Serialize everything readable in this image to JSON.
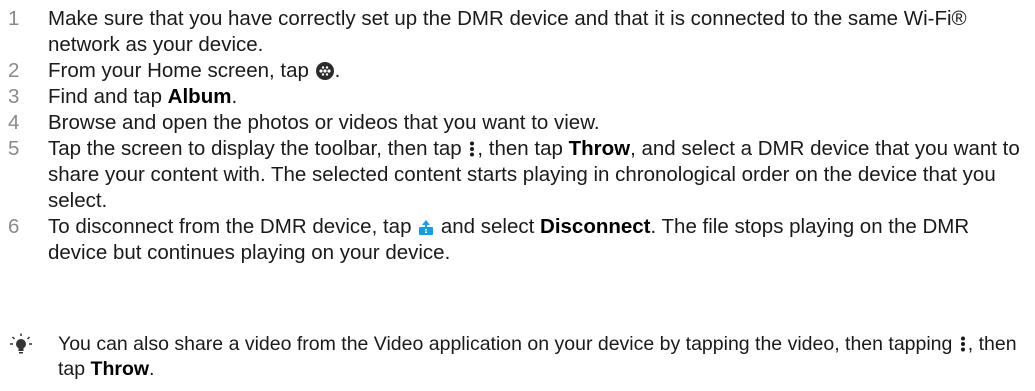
{
  "steps": [
    {
      "num": "1",
      "text": "Make sure that you have correctly set up the DMR device and that it is connected to the same Wi-Fi® network as your device."
    },
    {
      "num": "2",
      "pre": "From your Home screen, tap ",
      "icon": "apps-icon",
      "post": "."
    },
    {
      "num": "3",
      "pre": "Find and tap ",
      "bold": "Album",
      "post": "."
    },
    {
      "num": "4",
      "text": "Browse and open the photos or videos that you want to view."
    },
    {
      "num": "5",
      "part1": "Tap the screen to display the toolbar, then tap ",
      "icon1": "more-vertical-icon",
      "part2": ", then tap ",
      "bold": "Throw",
      "part3": ", and select a DMR device that you want to share your content with. The selected content starts playing in chronological order on the device that you select."
    },
    {
      "num": "6",
      "pre": "To disconnect from the DMR device, tap ",
      "icon": "throw-icon",
      "mid": " and select ",
      "bold": "Disconnect",
      "post": ". The file stops playing on the DMR device but continues playing on your device."
    }
  ],
  "tip": {
    "icon": "lightbulb-icon",
    "pre": "You can also share a video from the Video application on your device by tapping the video, then tapping ",
    "icon2": "more-vertical-icon",
    "mid": ", then tap ",
    "bold": "Throw",
    "post": "."
  },
  "colors": {
    "text": "#1a1a1a",
    "step_number": "#8a8a8a",
    "throw_icon": "#1a9de0",
    "tip_icon": "#333333"
  }
}
